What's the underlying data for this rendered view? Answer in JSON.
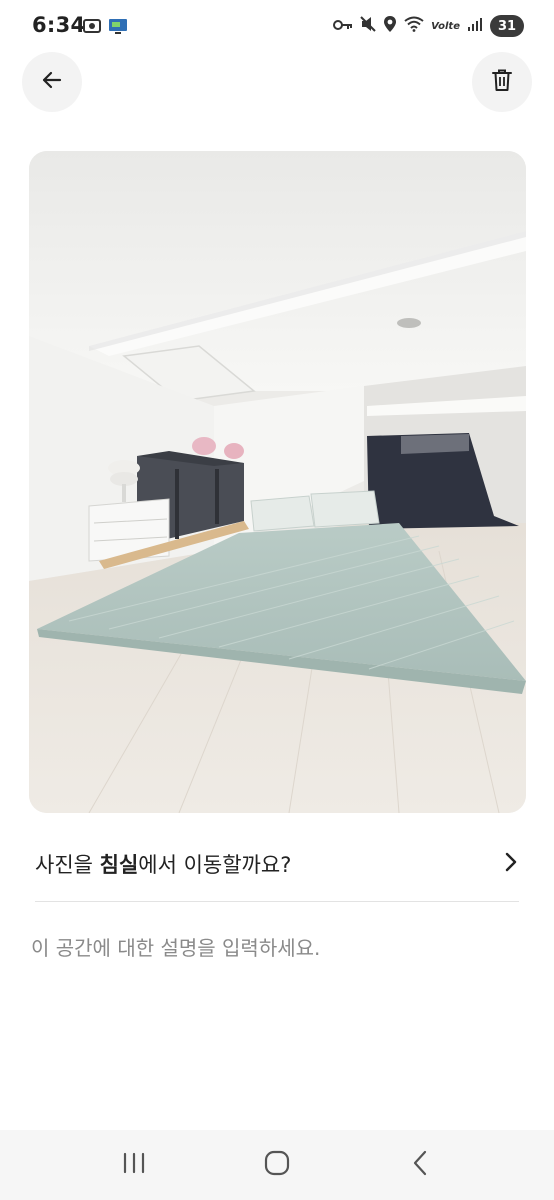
{
  "status_bar": {
    "time": "6:34",
    "network_label": "Volte",
    "battery": "31",
    "icons": [
      "camera-icon",
      "screen-share-icon",
      "vpn-key-icon",
      "mute-icon",
      "location-icon",
      "wifi-icon",
      "signal-icon",
      "battery-icon"
    ]
  },
  "header": {
    "back_icon": "arrow-left-icon",
    "delete_icon": "trash-icon"
  },
  "photo": {
    "subject": "bedroom-loft-photo"
  },
  "move_prompt": {
    "prefix": "사진을 ",
    "room": "침실",
    "suffix": "에서 이동할까요?",
    "icon": "chevron-right-icon"
  },
  "description": {
    "value": "",
    "placeholder": "이 공간에 대한 설명을 입력하세요."
  },
  "nav_bar": {
    "icons": [
      "recent-apps-icon",
      "home-icon",
      "back-nav-icon"
    ]
  },
  "colors": {
    "button_bg": "#f3f3f3",
    "divider": "#e3e3e3",
    "placeholder": "#8a8a8a",
    "navbar_bg": "#f6f6f6"
  }
}
